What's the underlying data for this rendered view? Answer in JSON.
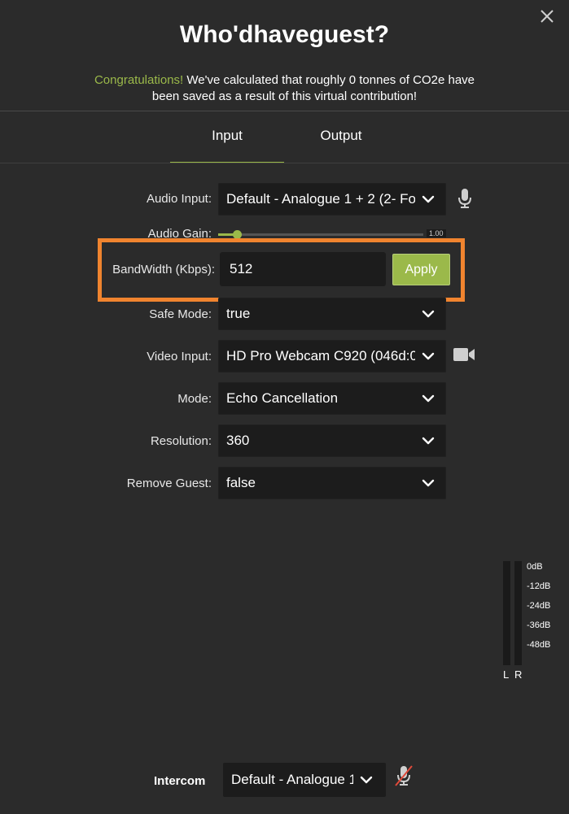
{
  "header": {
    "title": "Who'dhaveguest?",
    "congrats_highlight": "Congratulations!",
    "congrats_line1": " We've calculated that roughly 0 tonnes of CO2e have",
    "congrats_line2": "been saved as a result of this virtual contribution!"
  },
  "tabs": [
    {
      "label": "Input",
      "active": true
    },
    {
      "label": "Output",
      "active": false
    }
  ],
  "form": {
    "audio_input": {
      "label": "Audio Input:",
      "value": "Default - Analogue 1 + 2 (2- Fo"
    },
    "audio_gain": {
      "label": "Audio Gain:",
      "value": "1.00",
      "level": 0.09
    },
    "bandwidth": {
      "label": "BandWidth (Kbps):",
      "value": "512",
      "apply_label": "Apply"
    },
    "safe_mode": {
      "label": "Safe Mode:",
      "value": "true"
    },
    "video_input": {
      "label": "Video Input:",
      "value": "HD Pro Webcam C920 (046d:0"
    },
    "mode": {
      "label": "Mode:",
      "value": "Echo Cancellation"
    },
    "resolution": {
      "label": "Resolution:",
      "value": "360"
    },
    "remove_guest": {
      "label": "Remove Guest:",
      "value": "false"
    }
  },
  "meter": {
    "labels": [
      "0dB",
      "-12dB",
      "-24dB",
      "-36dB",
      "-48dB"
    ],
    "left_channel": "L",
    "right_channel": "R"
  },
  "intercom": {
    "label": "Intercom",
    "value": "Default - Analogue 1"
  },
  "icons": {
    "close": "close-icon",
    "mic": "microphone-icon",
    "camera": "video-camera-icon",
    "mic_muted": "microphone-muted-icon",
    "dropdown": "chevron-down-icon"
  },
  "colors": {
    "accent": "#9bb94a",
    "highlight_frame": "#f0842f",
    "background": "#2b2b2b",
    "field": "#1c1c1c",
    "mute_slash": "#e04a3a"
  }
}
